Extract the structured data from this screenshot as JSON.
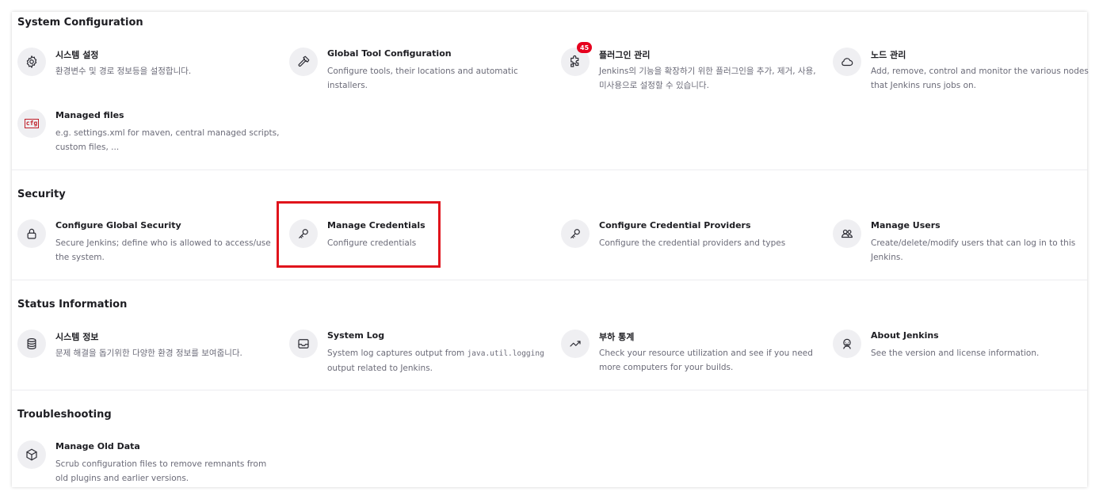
{
  "sections": [
    {
      "title": "System Configuration",
      "items": [
        {
          "title": "시스템 설정",
          "desc": "환경변수 및 경로 정보등을 설정합니다.",
          "icon": "gear-icon"
        },
        {
          "title": "Global Tool Configuration",
          "desc": "Configure tools, their locations and automatic installers.",
          "icon": "hammer-icon"
        },
        {
          "title": "플러그인 관리",
          "desc": "Jenkins의 기능을 확장하기 위한 플러그인을 추가, 제거, 사용, 미사용으로 설정할 수 있습니다.",
          "icon": "puzzle-icon",
          "badge": "45"
        },
        {
          "title": "노드 관리",
          "desc": "Add, remove, control and monitor the various nodes that Jenkins runs jobs on.",
          "icon": "cloud-icon"
        },
        {
          "title": "Managed files",
          "desc": "e.g. settings.xml for maven, central managed scripts, custom files, ...",
          "icon": "cfg-file-icon",
          "icon_text": "cfg"
        }
      ]
    },
    {
      "title": "Security",
      "items": [
        {
          "title": "Configure Global Security",
          "desc": "Secure Jenkins; define who is allowed to access/use the system.",
          "icon": "lock-icon"
        },
        {
          "title": "Manage Credentials",
          "desc": "Configure credentials",
          "icon": "key-icon"
        },
        {
          "title": "Configure Credential Providers",
          "desc": "Configure the credential providers and types",
          "icon": "key-icon"
        },
        {
          "title": "Manage Users",
          "desc": "Create/delete/modify users that can log in to this Jenkins.",
          "icon": "users-icon"
        }
      ]
    },
    {
      "title": "Status Information",
      "items": [
        {
          "title": "시스템 정보",
          "desc": "문제 해결을 돕기위한 다양한 환경 정보를 보여줍니다.",
          "icon": "database-icon"
        },
        {
          "title": "System Log",
          "desc_pre": "System log captures output from ",
          "desc_code": "java.util.logging",
          "desc_post": " output related to Jenkins.",
          "icon": "inbox-icon"
        },
        {
          "title": "부하 통계",
          "desc": "Check your resource utilization and see if you need more computers for your builds.",
          "icon": "trend-icon"
        },
        {
          "title": "About Jenkins",
          "desc": "See the version and license information.",
          "icon": "jenkins-icon"
        }
      ]
    },
    {
      "title": "Troubleshooting",
      "items": [
        {
          "title": "Manage Old Data",
          "desc": "Scrub configuration files to remove remnants from old plugins and earlier versions.",
          "icon": "box-icon"
        }
      ]
    }
  ],
  "colors": {
    "badge": "#e6001e",
    "highlight": "#e0141c",
    "icon_bg": "#efeff2",
    "desc_text": "#6b6b78"
  }
}
